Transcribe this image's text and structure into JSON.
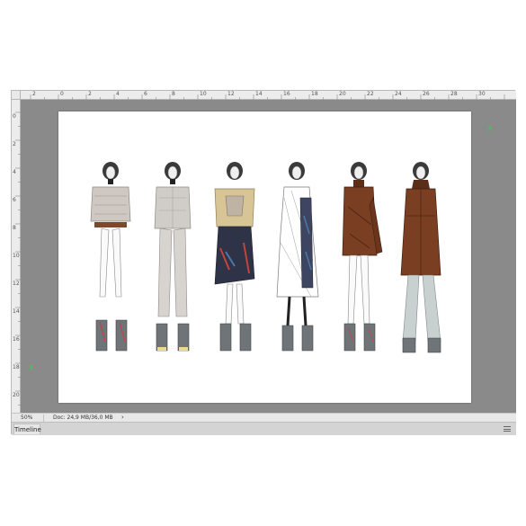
{
  "rulers": {
    "horizontal": [
      "2",
      "0",
      "2",
      "4",
      "6",
      "8",
      "10",
      "12",
      "14",
      "16",
      "18",
      "20",
      "22",
      "24",
      "26",
      "28",
      "30"
    ],
    "vertical": [
      "0",
      "2",
      "4",
      "6",
      "8",
      "10",
      "12",
      "14",
      "16",
      "18",
      "20"
    ]
  },
  "guides": {
    "top_right": "x",
    "bottom_left": "x"
  },
  "status_bar": {
    "zoom": "50%",
    "doc_info": "Doc: 24,9 MB/36,0 MB",
    "arrow": "›"
  },
  "timeline": {
    "tab_label": "Timeline"
  },
  "colors": {
    "canvas_background": "#8a8a8a",
    "guide": "#39d04a",
    "look_colors": [
      "#cfc8c2",
      "#d0ccc7",
      "#d8c596",
      "#ffffff",
      "#7a3f22",
      "#7a3f22"
    ]
  },
  "artwork": {
    "looks": [
      "look-1",
      "look-2",
      "look-3",
      "look-4",
      "look-5",
      "look-6"
    ]
  }
}
